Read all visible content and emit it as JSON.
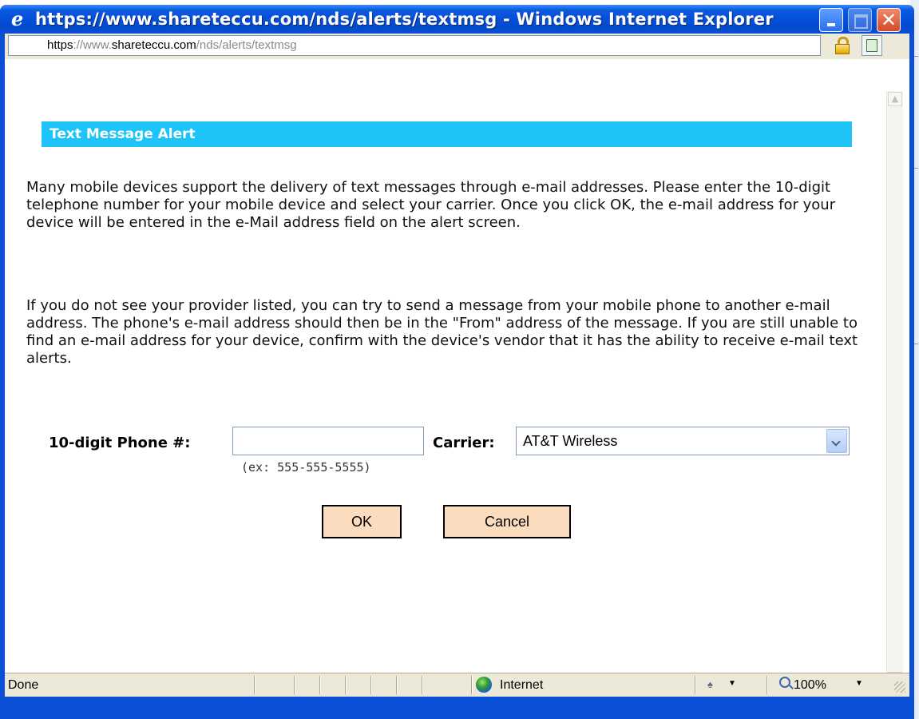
{
  "window": {
    "title": "https://www.shareteccu.com/nds/alerts/textmsg - Windows Internet Explorer",
    "minimize_icon": "minimize-icon",
    "maximize_icon": "maximize-icon",
    "close_icon": "close-icon",
    "close_glyph": "✕"
  },
  "address": {
    "scheme": "https",
    "scheme_sep": "://www.",
    "host": "shareteccu.com",
    "path": "/nds/alerts/textmsg"
  },
  "dialog": {
    "header": "Text Message Alert",
    "paragraph1": "Many mobile devices support the delivery of text messages through e-mail addresses. Please enter the 10-digit telephone number for your mobile device and select your carrier. Once you click OK, the e-mail address for your device will be entered in the e-Mail address field on the alert screen.",
    "paragraph2": "If you do not see your provider listed, you can try to send a message from your mobile phone to another e-mail address. The phone's e-mail address should then be in the \"From\" address of the message. If you are still unable to find an e-mail address for your device, confirm with the device's vendor that it has the ability to receive e-mail text alerts.",
    "phone_label": "10-digit Phone #:",
    "phone_value": "",
    "phone_hint": "(ex: 555-555-5555)",
    "carrier_label": "Carrier:",
    "carrier_selected": "AT&T Wireless",
    "ok_label": "OK",
    "cancel_label": "Cancel"
  },
  "status": {
    "text": "Done",
    "zone": "Internet",
    "zoom": "100%"
  },
  "colors": {
    "title_bar": "#0a5be0",
    "alert_header": "#1ec3f7",
    "button_fill": "#fcdcbf"
  }
}
